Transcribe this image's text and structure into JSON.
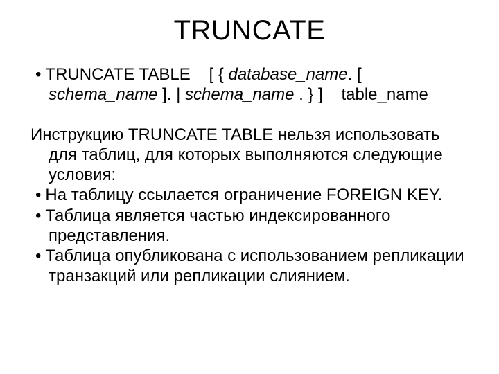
{
  "title": "TRUNCATE",
  "syntax": {
    "bullet": "•",
    "lead": "TRUNCATE TABLE    [ { ",
    "db": "database_name",
    "mid1": ". [ ",
    "schema1": "schema_name",
    "mid2": " ]. | ",
    "schema2": "schema_name",
    "mid3": " . } ]    table_name"
  },
  "intro": "Инструкцию TRUNCATE TABLE нельзя использовать для таблиц, для которых выполняются следующие условия:",
  "points": [
    {
      "bullet": "•",
      "text": "На таблицу ссылается ограничение FOREIGN KEY."
    },
    {
      "bullet": "•",
      "text": "Таблица является частью индексированного представления."
    },
    {
      "bullet": "•",
      "text": "Таблица опубликована с использованием репликации транзакций или репликации слиянием."
    }
  ]
}
